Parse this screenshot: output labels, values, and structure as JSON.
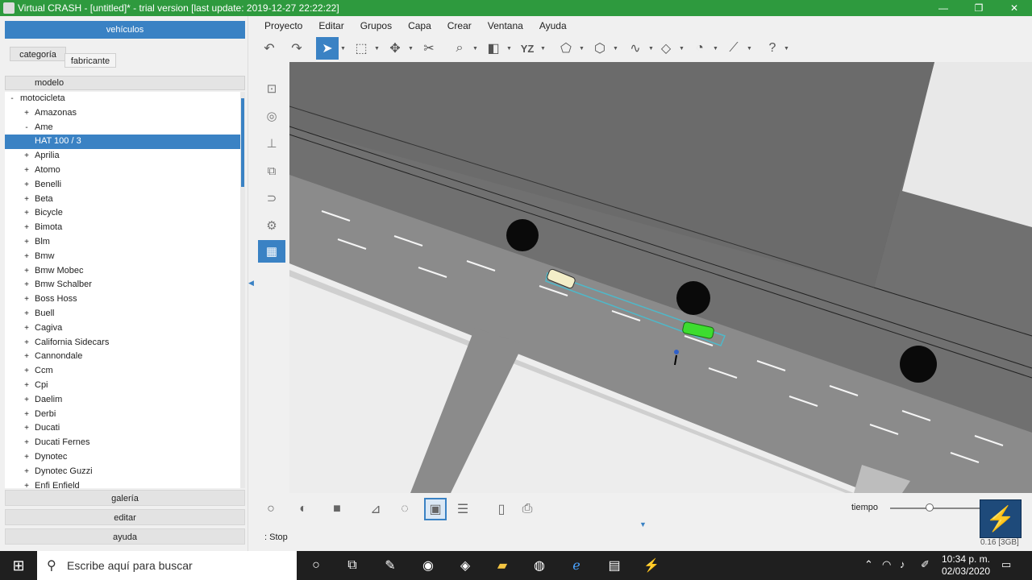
{
  "window": {
    "title": "Virtual CRASH - [untitled]* - trial version [last update: 2019-12-27 22:22:22]",
    "controls": {
      "minimize": "—",
      "restore": "❐",
      "close": "✕"
    }
  },
  "left_panel": {
    "header": "vehículos",
    "tabs": {
      "categoria": "categoría",
      "fabricante": "fabricante"
    },
    "column_header": "modelo",
    "tree": [
      {
        "exp": "-",
        "label": "motocicleta",
        "level": 0
      },
      {
        "exp": "+",
        "label": "Amazonas",
        "level": 1
      },
      {
        "exp": "-",
        "label": "Ame",
        "level": 1
      },
      {
        "exp": "",
        "label": "HAT 100 / 3",
        "level": 2,
        "selected": true
      },
      {
        "exp": "+",
        "label": "Aprilia",
        "level": 1
      },
      {
        "exp": "+",
        "label": "Atomo",
        "level": 1
      },
      {
        "exp": "+",
        "label": "Benelli",
        "level": 1
      },
      {
        "exp": "+",
        "label": "Beta",
        "level": 1
      },
      {
        "exp": "+",
        "label": "Bicycle",
        "level": 1
      },
      {
        "exp": "+",
        "label": "Bimota",
        "level": 1
      },
      {
        "exp": "+",
        "label": "Blm",
        "level": 1
      },
      {
        "exp": "+",
        "label": "Bmw",
        "level": 1
      },
      {
        "exp": "+",
        "label": "Bmw Mobec",
        "level": 1
      },
      {
        "exp": "+",
        "label": "Bmw Schalber",
        "level": 1
      },
      {
        "exp": "+",
        "label": "Boss Hoss",
        "level": 1
      },
      {
        "exp": "+",
        "label": "Buell",
        "level": 1
      },
      {
        "exp": "+",
        "label": "Cagiva",
        "level": 1
      },
      {
        "exp": "+",
        "label": "California Sidecars",
        "level": 1
      },
      {
        "exp": "+",
        "label": "Cannondale",
        "level": 1
      },
      {
        "exp": "+",
        "label": "Ccm",
        "level": 1
      },
      {
        "exp": "+",
        "label": "Cpi",
        "level": 1
      },
      {
        "exp": "+",
        "label": "Daelim",
        "level": 1
      },
      {
        "exp": "+",
        "label": "Derbi",
        "level": 1
      },
      {
        "exp": "+",
        "label": "Ducati",
        "level": 1
      },
      {
        "exp": "+",
        "label": "Ducati Fernes",
        "level": 1
      },
      {
        "exp": "+",
        "label": "Dynotec",
        "level": 1
      },
      {
        "exp": "+",
        "label": "Dynotec Guzzi",
        "level": 1
      },
      {
        "exp": "+",
        "label": "Enfi Enfield",
        "level": 1
      }
    ],
    "buttons": {
      "galeria": "galería",
      "editar": "editar",
      "ayuda": "ayuda"
    }
  },
  "menu": [
    "Proyecto",
    "Editar",
    "Grupos",
    "Capa",
    "Crear",
    "Ventana",
    "Ayuda"
  ],
  "toolbar_icons": [
    "undo-icon",
    "redo-icon",
    "select-arrow-icon",
    "rectangle-select-icon",
    "move-gizmo-icon",
    "delete-cross-icon",
    "zoom-icon",
    "cube-view-icon",
    "yz-plane-icon",
    "shape-icon",
    "polygon-icon",
    "path-icon",
    "measure-icon",
    "angle-icon",
    "ruler-icon",
    "help-icon"
  ],
  "toolbar_labels": {
    "yz": "YZ"
  },
  "bottom": {
    "tiempo_label": "tiempo",
    "status": ": Stop",
    "memory": "0.16 [3GB]"
  },
  "taskbar": {
    "search_placeholder": "Escribe aquí para buscar",
    "time": "10:34 p. m.",
    "date": "02/03/2020"
  },
  "colors": {
    "title_green": "#2e9a3e",
    "accent_blue": "#3a82c4",
    "car_green": "#3ddc2f",
    "car_white": "#f3eec8"
  }
}
